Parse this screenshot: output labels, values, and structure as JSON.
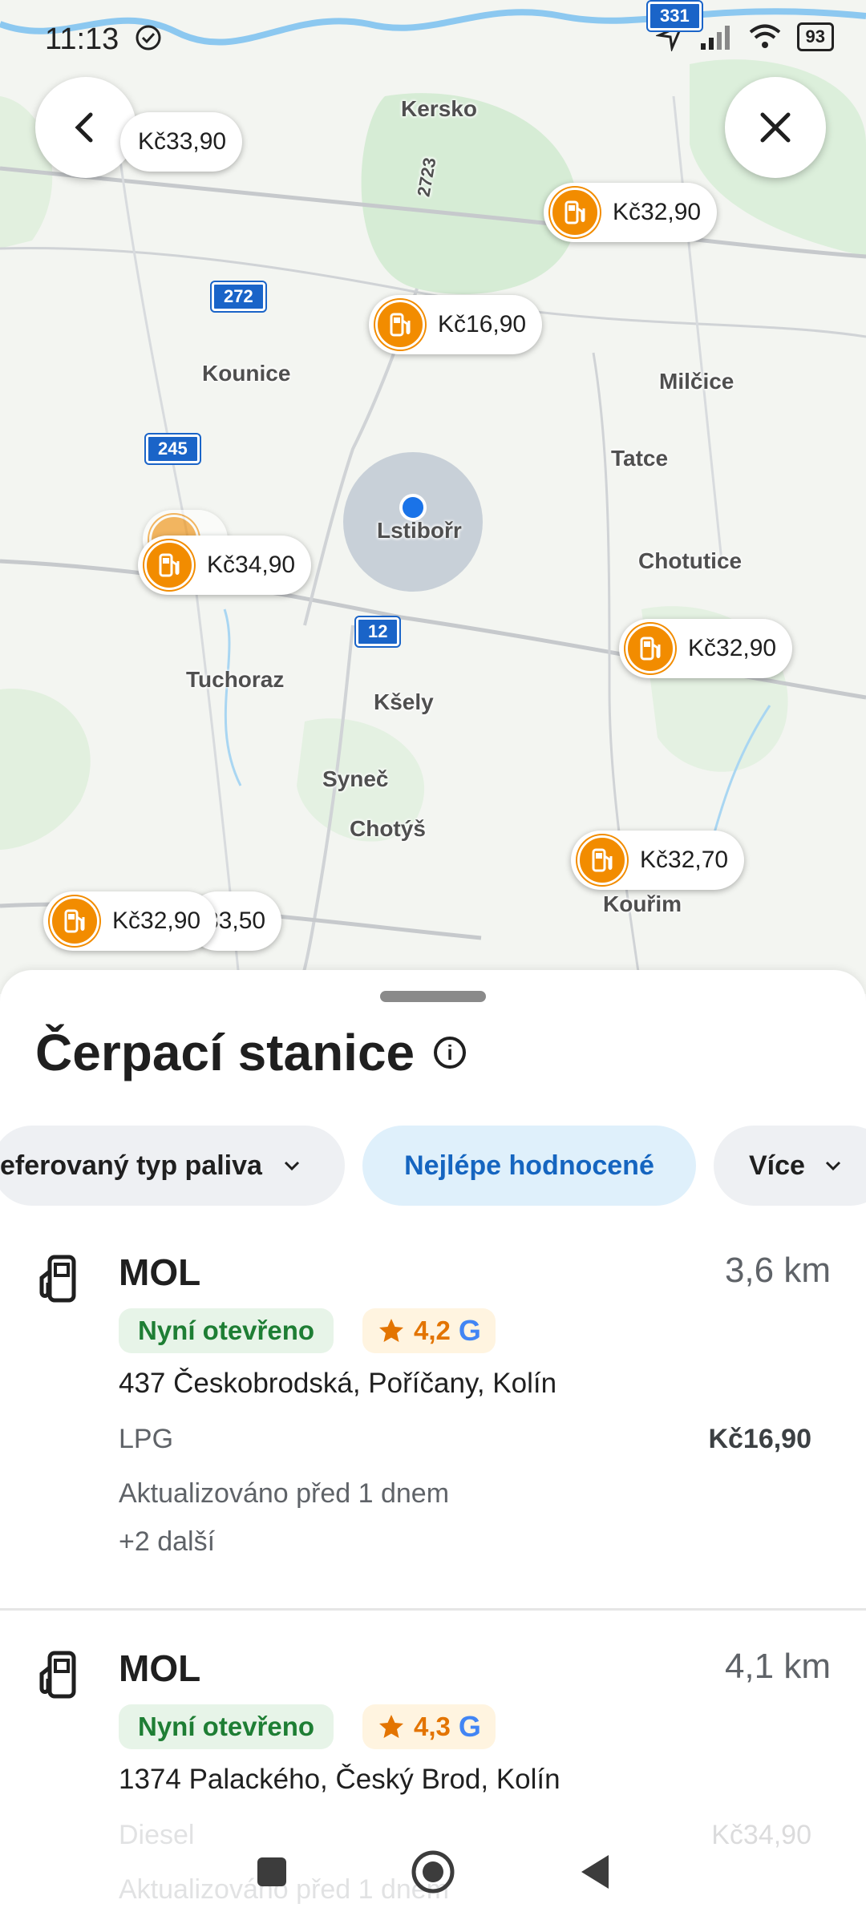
{
  "status_bar": {
    "time": "11:13",
    "battery": "93"
  },
  "map": {
    "places": [
      {
        "id": "kersko",
        "name": "Kersko"
      },
      {
        "id": "kounice",
        "name": "Kounice"
      },
      {
        "id": "milcice",
        "name": "Milčice"
      },
      {
        "id": "tatce",
        "name": "Tatce"
      },
      {
        "id": "lstibor",
        "name": "Lstibořr"
      },
      {
        "id": "chotutice",
        "name": "Chotutice"
      },
      {
        "id": "tuchoraz",
        "name": "Tuchoraz"
      },
      {
        "id": "ksely",
        "name": "Kšely"
      },
      {
        "id": "synec",
        "name": "Syneč"
      },
      {
        "id": "chotys",
        "name": "Chotýš"
      },
      {
        "id": "kourim",
        "name": "Kouřim"
      }
    ],
    "road_numbers": [
      "331",
      "272",
      "245",
      "12",
      "2723"
    ],
    "pins": [
      {
        "price": "Kč33,90"
      },
      {
        "price": "Kč32,90"
      },
      {
        "price": "Kč16,90"
      },
      {
        "price": "Kč34,90"
      },
      {
        "price": "Kč32,90"
      },
      {
        "price": "Kč32,70"
      },
      {
        "price": "Kč32,90"
      },
      {
        "price": "33,50"
      }
    ]
  },
  "sheet": {
    "title": "Čerpací stanice",
    "filters": [
      {
        "label": "eferovaný typ paliva"
      },
      {
        "label": "Nejlépe hodnocené"
      },
      {
        "label": "Více"
      }
    ],
    "results": [
      {
        "name": "MOL",
        "distance": "3,6 km",
        "open": "Nyní otevřeno",
        "rating": "4,2",
        "address": "437 Českobrodská, Poříčany, Kolín",
        "fuel": "LPG",
        "price": "Kč16,90",
        "updated": "Aktualizováno před 1 dnem",
        "more": "+2 další"
      },
      {
        "name": "MOL",
        "distance": "4,1 km",
        "open": "Nyní otevřeno",
        "rating": "4,3",
        "address": "1374 Palackého, Český Brod, Kolín",
        "fuel": "Diesel",
        "price": "Kč34,90",
        "updated": "Aktualizováno před 1 dnem"
      }
    ]
  },
  "colors": {
    "accent": "#1565c0",
    "pin": "#f28c00",
    "open": "#1e7e34",
    "rating": "#e37400"
  }
}
